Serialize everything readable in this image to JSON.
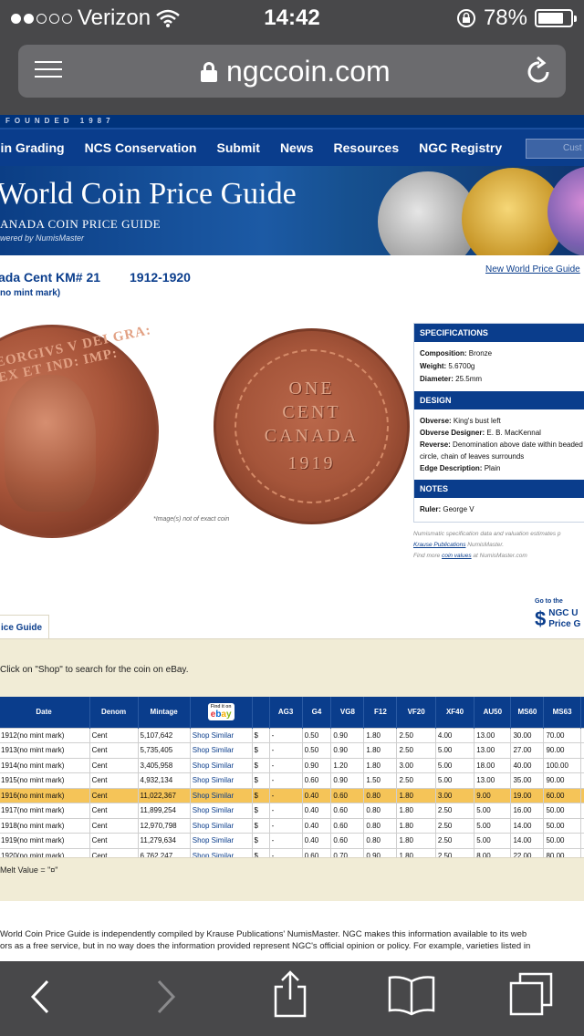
{
  "status_bar": {
    "carrier": "Verizon",
    "time": "14:42",
    "battery": "78%",
    "battery_level": 0.78
  },
  "browser": {
    "url": "ngccoin.com"
  },
  "site": {
    "founded": "FOUNDED 1987",
    "nav": [
      "oin Grading",
      "NCS Conservation",
      "Submit",
      "News",
      "Resources",
      "NGC Registry"
    ],
    "search_placeholder": "Cust",
    "banner_title": "World Coin Price Guide",
    "banner_subtitle": "ANADA COIN PRICE GUIDE",
    "banner_powered": "wered by NumisMaster"
  },
  "coin": {
    "title": "ada Cent KM# 21",
    "years": "1912-1920",
    "subtitle": "no mint mark)",
    "new_link": "New World Price Guide",
    "obverse_legend": "GEORGIVS V DEI GRA: REX ET IND: IMP:",
    "reverse_lines": [
      "ONE",
      "CENT",
      "CANADA",
      "1919"
    ],
    "image_note": "*Image(s) not of exact coin"
  },
  "specs": {
    "specifications_header": "SPECIFICATIONS",
    "composition_label": "Composition:",
    "composition": "Bronze",
    "weight_label": "Weight:",
    "weight": "5.6700g",
    "diameter_label": "Diameter:",
    "diameter": "25.5mm",
    "design_header": "DESIGN",
    "obverse_label": "Obverse:",
    "obverse": "King's bust left",
    "obverse_designer_label": "Obverse Designer:",
    "obverse_designer": "E. B. MacKennal",
    "reverse_label": "Reverse:",
    "reverse": "Denomination above date within beaded circle, chain of leaves surrounds",
    "edge_label": "Edge Description:",
    "edge": "Plain",
    "notes_header": "NOTES",
    "ruler_label": "Ruler:",
    "ruler": "George V",
    "foot1": "Numismatic specification data and valuation estimates p",
    "foot2_link": "Krause Publications",
    "foot2_rest": " NumisMaster.",
    "foot3_pre": "Find more ",
    "foot3_link": "coin values",
    "foot3_post": " at NumisMaster.com"
  },
  "ngc_link": {
    "go_to": "Go to the",
    "line1": "NGC U",
    "line2": "Price G"
  },
  "tab_label": "ice Guide",
  "shop_note": "Click on \"Shop\" to search for the coin on eBay.",
  "table": {
    "headers": [
      "Date",
      "Denom",
      "Mintage",
      "",
      "",
      "AG3",
      "G4",
      "VG8",
      "F12",
      "VF20",
      "XF40",
      "AU50",
      "MS60",
      "MS63",
      "|"
    ],
    "ebay_small": "Find it on",
    "rows": [
      [
        "1912(no mint mark)",
        "Cent",
        "5,107,642",
        "Shop Similar",
        "$",
        "-",
        "0.50",
        "0.90",
        "1.80",
        "2.50",
        "4.00",
        "13.00",
        "30.00",
        "70.00"
      ],
      [
        "1913(no mint mark)",
        "Cent",
        "5,735,405",
        "Shop Similar",
        "$",
        "-",
        "0.50",
        "0.90",
        "1.80",
        "2.50",
        "5.00",
        "13.00",
        "27.00",
        "90.00"
      ],
      [
        "1914(no mint mark)",
        "Cent",
        "3,405,958",
        "Shop Similar",
        "$",
        "-",
        "0.90",
        "1.20",
        "1.80",
        "3.00",
        "5.00",
        "18.00",
        "40.00",
        "100.00"
      ],
      [
        "1915(no mint mark)",
        "Cent",
        "4,932,134",
        "Shop Similar",
        "$",
        "-",
        "0.60",
        "0.90",
        "1.50",
        "2.50",
        "5.00",
        "13.00",
        "35.00",
        "90.00"
      ],
      [
        "1916(no mint mark)",
        "Cent",
        "11,022,367",
        "Shop Similar",
        "$",
        "-",
        "0.40",
        "0.60",
        "0.80",
        "1.80",
        "3.00",
        "9.00",
        "19.00",
        "60.00"
      ],
      [
        "1917(no mint mark)",
        "Cent",
        "11,899,254",
        "Shop Similar",
        "$",
        "-",
        "0.40",
        "0.60",
        "0.80",
        "1.80",
        "2.50",
        "5.00",
        "16.00",
        "50.00"
      ],
      [
        "1918(no mint mark)",
        "Cent",
        "12,970,798",
        "Shop Similar",
        "$",
        "-",
        "0.40",
        "0.60",
        "0.80",
        "1.80",
        "2.50",
        "5.00",
        "14.00",
        "50.00"
      ],
      [
        "1919(no mint mark)",
        "Cent",
        "11,279,634",
        "Shop Similar",
        "$",
        "-",
        "0.40",
        "0.60",
        "0.80",
        "1.80",
        "2.50",
        "5.00",
        "14.00",
        "50.00"
      ],
      [
        "1920(no mint mark)",
        "Cent",
        "6,762,247",
        "Shop Similar",
        "$",
        "-",
        "0.60",
        "0.70",
        "0.90",
        "1.80",
        "2.50",
        "8.00",
        "22.00",
        "80.00"
      ]
    ],
    "highlight_row": 4,
    "highlight_color": "#f5c458"
  },
  "melt_value": "Melt Value = \"¤\"",
  "disclaimer": [
    " World Coin Price Guide is independently compiled by Krause Publications' NumisMaster. NGC makes this information available to its web",
    "ors as a free service, but in no way does the information provided represent NGC's official opinion or policy. For example, varieties listed in"
  ],
  "colors": {
    "nav_blue": "#0a3d8c",
    "bar_gray": "#48484a",
    "cream": "#f1ecd6"
  }
}
